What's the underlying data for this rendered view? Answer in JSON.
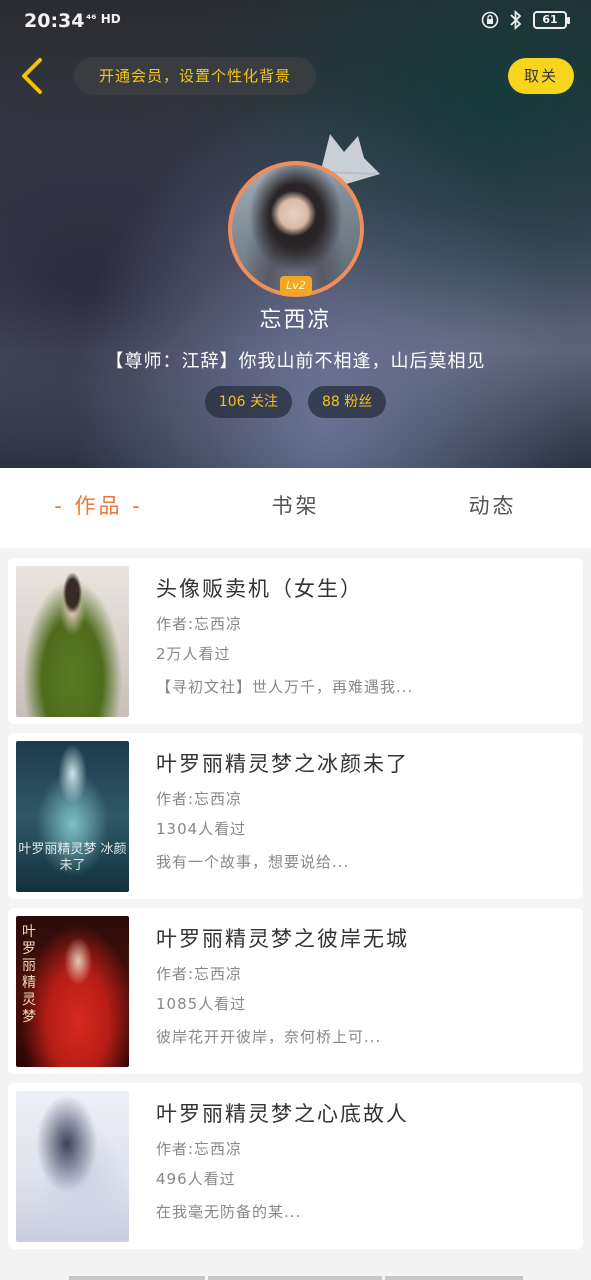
{
  "status_bar": {
    "time": "20:34",
    "network": "⁴⁶ HD",
    "battery": "61"
  },
  "header": {
    "vip_text": "开通会员，设置个性化背景",
    "follow_label": "取关"
  },
  "profile": {
    "level": "Lv2",
    "name": "忘西凉",
    "signature": "【尊师：江辞】你我山前不相逢，山后莫相见",
    "following": "106 关注",
    "fans": "88 粉丝"
  },
  "tabs": [
    {
      "label": "- 作品 -",
      "active": true
    },
    {
      "label": "书架",
      "active": false
    },
    {
      "label": "动态",
      "active": false
    }
  ],
  "works": [
    {
      "title": "头像贩卖机（女生）",
      "author": "作者:忘西凉",
      "views": "2万人看过",
      "desc": "【寻初文社】世人万千，再难遇我...",
      "cover_text": ""
    },
    {
      "title": "叶罗丽精灵梦之冰颜未了",
      "author": "作者:忘西凉",
      "views": "1304人看过",
      "desc": "我有一个故事，想要说给...",
      "cover_text": "叶罗丽精灵梦 冰颜未了"
    },
    {
      "title": "叶罗丽精灵梦之彼岸无城",
      "author": "作者:忘西凉",
      "views": "1085人看过",
      "desc": "彼岸花开开彼岸，奈何桥上可...",
      "cover_text": "叶罗丽精灵梦"
    },
    {
      "title": "叶罗丽精灵梦之心底故人",
      "author": "作者:忘西凉",
      "views": "496人看过",
      "desc": "在我毫无防备的某...",
      "cover_text": ""
    }
  ],
  "colors": {
    "accent": "#e9773e",
    "gold": "#f3c51a",
    "follow_button": "#f7d51f",
    "avatar_ring": "#ef8e5a"
  },
  "icons": {
    "back": "back-chevron-icon",
    "crown": "crown-icon",
    "bluetooth": "bluetooth-icon",
    "lock": "rotation-lock-icon",
    "signal": "signal-icon"
  }
}
